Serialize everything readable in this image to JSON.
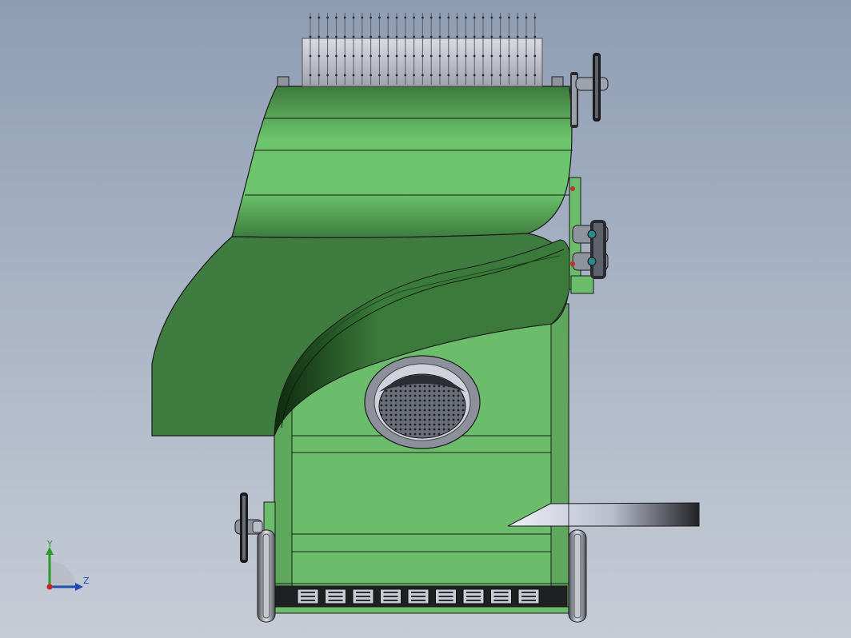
{
  "viewport": {
    "description_free": true,
    "background_gradient": [
      "#8e9db3",
      "#a8b3c4",
      "#c6ccd6"
    ]
  },
  "colors": {
    "frame_green": "#6bbd6b",
    "frame_green_light": "#78c878",
    "hood_dark": "#3e7a3e",
    "hood_light": "#6cc06c",
    "outline": "#1a1a1a",
    "steel": "#c9cdd6",
    "steel_dark": "#5a5f6a"
  },
  "axis_triad": {
    "y_label": "Y",
    "z_label": "Z",
    "y_color": "#2a9a2a",
    "z_color": "#1e4fb0",
    "x_color": "#d02020"
  },
  "icons": [
    "axis-triad-icon",
    "drive-pulley-icon",
    "sprocket-icon",
    "wheel-icon"
  ]
}
